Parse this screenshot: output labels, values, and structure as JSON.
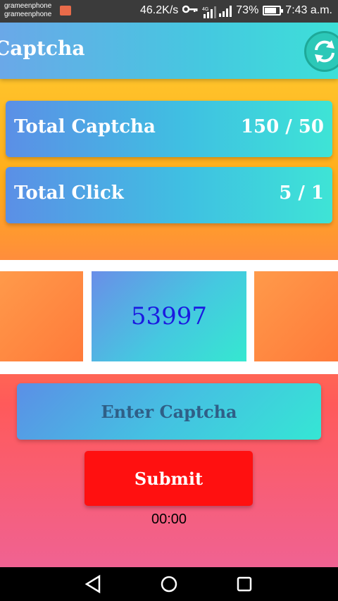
{
  "status_bar": {
    "carrier_1": "grameenphone",
    "carrier_2": "grameenphone",
    "network_speed": "46.2K/s",
    "network_type": "4G",
    "battery": "73%",
    "time": "7:43 a.m."
  },
  "app_bar": {
    "title": "Captcha",
    "refresh_icon": "refresh-icon"
  },
  "stats": {
    "total_captcha_label": "Total Captcha",
    "total_captcha_value": "150 / 50",
    "total_click_label": "Total Click",
    "total_click_value": "5 / 1"
  },
  "captcha": {
    "code": "53997"
  },
  "input": {
    "placeholder": "Enter Captcha",
    "value": ""
  },
  "submit_label": "Submit",
  "timer": "00:00",
  "nav": {
    "back_icon": "back-icon",
    "home_icon": "home-icon",
    "recents_icon": "recents-icon"
  }
}
